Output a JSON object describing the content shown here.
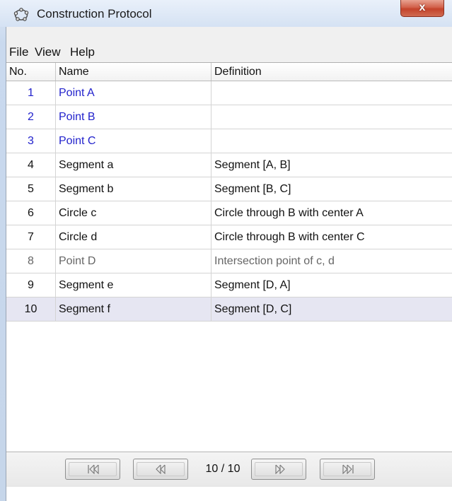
{
  "window": {
    "title": "Construction Protocol",
    "close_label": "x"
  },
  "menu": {
    "items": [
      "File",
      "View",
      "Help"
    ]
  },
  "table": {
    "columns": [
      "No.",
      "Name",
      "Definition"
    ],
    "rows": [
      {
        "no": "1",
        "name": "Point A",
        "definition": "",
        "style": "blue"
      },
      {
        "no": "2",
        "name": "Point B",
        "definition": "",
        "style": "blue"
      },
      {
        "no": "3",
        "name": "Point C",
        "definition": "",
        "style": "blue"
      },
      {
        "no": "4",
        "name": "Segment a",
        "definition": "Segment [A, B]",
        "style": "black"
      },
      {
        "no": "5",
        "name": "Segment b",
        "definition": "Segment [B, C]",
        "style": "black"
      },
      {
        "no": "6",
        "name": "Circle c",
        "definition": "Circle through B with center A",
        "style": "black"
      },
      {
        "no": "7",
        "name": "Circle d",
        "definition": "Circle through B with center C",
        "style": "black"
      },
      {
        "no": "8",
        "name": "Point D",
        "definition": "Intersection point of c, d",
        "style": "gray"
      },
      {
        "no": "9",
        "name": "Segment e",
        "definition": "Segment [D, A]",
        "style": "black"
      },
      {
        "no": "10",
        "name": "Segment f",
        "definition": "Segment [D, C]",
        "style": "black",
        "selected": true
      }
    ]
  },
  "navigation": {
    "first_icon": "skip-to-first-icon",
    "prev_icon": "step-back-icon",
    "counter": "10 / 10",
    "next_icon": "step-forward-icon",
    "last_icon": "skip-to-last-icon"
  },
  "colors": {
    "free_object": "#2222cc",
    "dependent_object": "#111111",
    "auxiliary_object": "#666666",
    "selected_row": "#e6e6f2",
    "close_button": "#c4432b"
  }
}
